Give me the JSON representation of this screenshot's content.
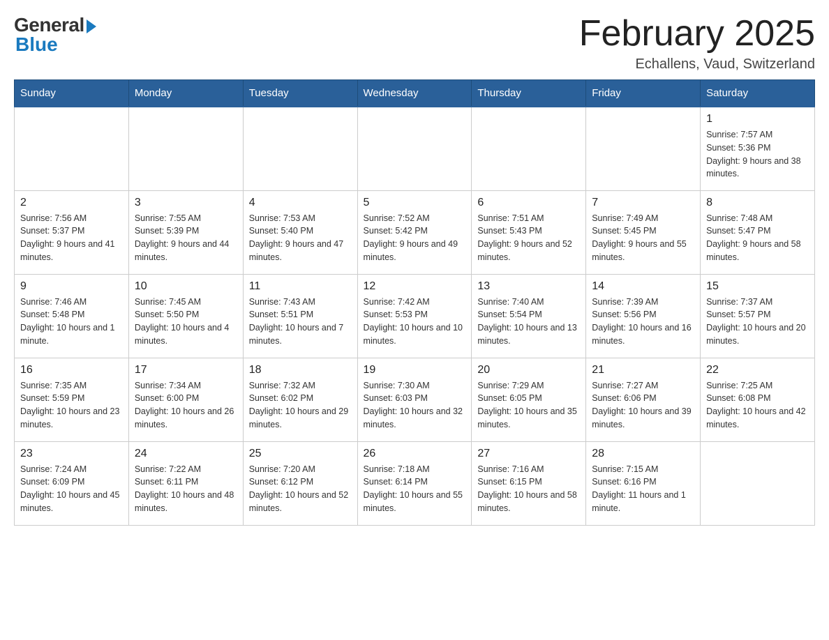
{
  "header": {
    "logo_general": "General",
    "logo_blue": "Blue",
    "month_title": "February 2025",
    "location": "Echallens, Vaud, Switzerland"
  },
  "days_of_week": [
    "Sunday",
    "Monday",
    "Tuesday",
    "Wednesday",
    "Thursday",
    "Friday",
    "Saturday"
  ],
  "weeks": [
    [
      {
        "num": "",
        "info": ""
      },
      {
        "num": "",
        "info": ""
      },
      {
        "num": "",
        "info": ""
      },
      {
        "num": "",
        "info": ""
      },
      {
        "num": "",
        "info": ""
      },
      {
        "num": "",
        "info": ""
      },
      {
        "num": "1",
        "info": "Sunrise: 7:57 AM\nSunset: 5:36 PM\nDaylight: 9 hours and 38 minutes."
      }
    ],
    [
      {
        "num": "2",
        "info": "Sunrise: 7:56 AM\nSunset: 5:37 PM\nDaylight: 9 hours and 41 minutes."
      },
      {
        "num": "3",
        "info": "Sunrise: 7:55 AM\nSunset: 5:39 PM\nDaylight: 9 hours and 44 minutes."
      },
      {
        "num": "4",
        "info": "Sunrise: 7:53 AM\nSunset: 5:40 PM\nDaylight: 9 hours and 47 minutes."
      },
      {
        "num": "5",
        "info": "Sunrise: 7:52 AM\nSunset: 5:42 PM\nDaylight: 9 hours and 49 minutes."
      },
      {
        "num": "6",
        "info": "Sunrise: 7:51 AM\nSunset: 5:43 PM\nDaylight: 9 hours and 52 minutes."
      },
      {
        "num": "7",
        "info": "Sunrise: 7:49 AM\nSunset: 5:45 PM\nDaylight: 9 hours and 55 minutes."
      },
      {
        "num": "8",
        "info": "Sunrise: 7:48 AM\nSunset: 5:47 PM\nDaylight: 9 hours and 58 minutes."
      }
    ],
    [
      {
        "num": "9",
        "info": "Sunrise: 7:46 AM\nSunset: 5:48 PM\nDaylight: 10 hours and 1 minute."
      },
      {
        "num": "10",
        "info": "Sunrise: 7:45 AM\nSunset: 5:50 PM\nDaylight: 10 hours and 4 minutes."
      },
      {
        "num": "11",
        "info": "Sunrise: 7:43 AM\nSunset: 5:51 PM\nDaylight: 10 hours and 7 minutes."
      },
      {
        "num": "12",
        "info": "Sunrise: 7:42 AM\nSunset: 5:53 PM\nDaylight: 10 hours and 10 minutes."
      },
      {
        "num": "13",
        "info": "Sunrise: 7:40 AM\nSunset: 5:54 PM\nDaylight: 10 hours and 13 minutes."
      },
      {
        "num": "14",
        "info": "Sunrise: 7:39 AM\nSunset: 5:56 PM\nDaylight: 10 hours and 16 minutes."
      },
      {
        "num": "15",
        "info": "Sunrise: 7:37 AM\nSunset: 5:57 PM\nDaylight: 10 hours and 20 minutes."
      }
    ],
    [
      {
        "num": "16",
        "info": "Sunrise: 7:35 AM\nSunset: 5:59 PM\nDaylight: 10 hours and 23 minutes."
      },
      {
        "num": "17",
        "info": "Sunrise: 7:34 AM\nSunset: 6:00 PM\nDaylight: 10 hours and 26 minutes."
      },
      {
        "num": "18",
        "info": "Sunrise: 7:32 AM\nSunset: 6:02 PM\nDaylight: 10 hours and 29 minutes."
      },
      {
        "num": "19",
        "info": "Sunrise: 7:30 AM\nSunset: 6:03 PM\nDaylight: 10 hours and 32 minutes."
      },
      {
        "num": "20",
        "info": "Sunrise: 7:29 AM\nSunset: 6:05 PM\nDaylight: 10 hours and 35 minutes."
      },
      {
        "num": "21",
        "info": "Sunrise: 7:27 AM\nSunset: 6:06 PM\nDaylight: 10 hours and 39 minutes."
      },
      {
        "num": "22",
        "info": "Sunrise: 7:25 AM\nSunset: 6:08 PM\nDaylight: 10 hours and 42 minutes."
      }
    ],
    [
      {
        "num": "23",
        "info": "Sunrise: 7:24 AM\nSunset: 6:09 PM\nDaylight: 10 hours and 45 minutes."
      },
      {
        "num": "24",
        "info": "Sunrise: 7:22 AM\nSunset: 6:11 PM\nDaylight: 10 hours and 48 minutes."
      },
      {
        "num": "25",
        "info": "Sunrise: 7:20 AM\nSunset: 6:12 PM\nDaylight: 10 hours and 52 minutes."
      },
      {
        "num": "26",
        "info": "Sunrise: 7:18 AM\nSunset: 6:14 PM\nDaylight: 10 hours and 55 minutes."
      },
      {
        "num": "27",
        "info": "Sunrise: 7:16 AM\nSunset: 6:15 PM\nDaylight: 10 hours and 58 minutes."
      },
      {
        "num": "28",
        "info": "Sunrise: 7:15 AM\nSunset: 6:16 PM\nDaylight: 11 hours and 1 minute."
      },
      {
        "num": "",
        "info": ""
      }
    ]
  ]
}
